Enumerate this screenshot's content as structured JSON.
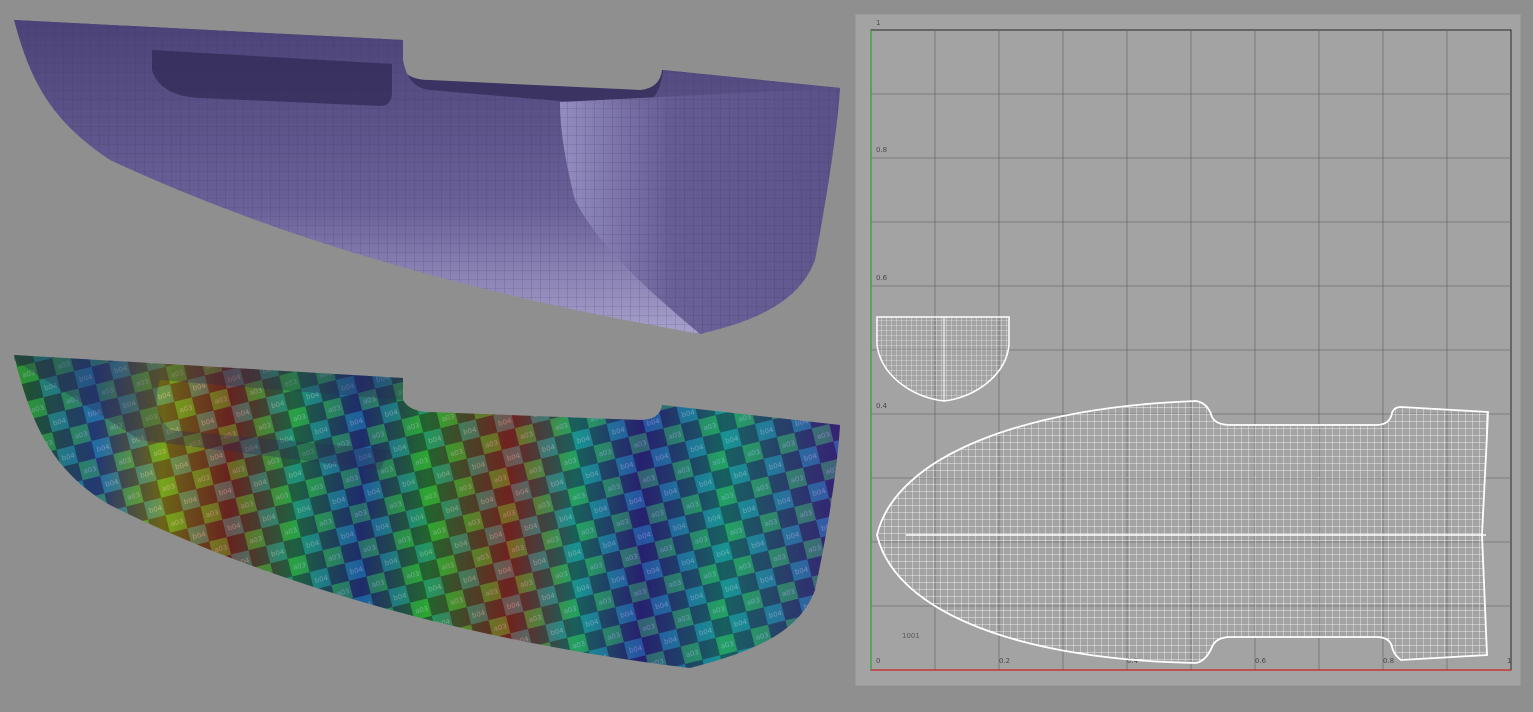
{
  "viewport": {
    "hull_color": "#5d5489",
    "checker_colors": [
      "#e0261a",
      "#f07a10",
      "#e8d21a",
      "#38c028",
      "#1fae5a",
      "#19b3b0",
      "#1a6fe0",
      "#3a2cd0",
      "#7a2ad8"
    ]
  },
  "uv_editor": {
    "axis": {
      "u_ticks": [
        "0",
        "0.2",
        "0.4",
        "0.6",
        "0.8",
        "1"
      ],
      "v_ticks": [
        "1",
        "0.8",
        "0.6",
        "0.4"
      ]
    },
    "udim_label": "1001",
    "u_axis_color": "#cc2222",
    "v_axis_color": "#22aa22",
    "shell_color": "#ffffff"
  }
}
